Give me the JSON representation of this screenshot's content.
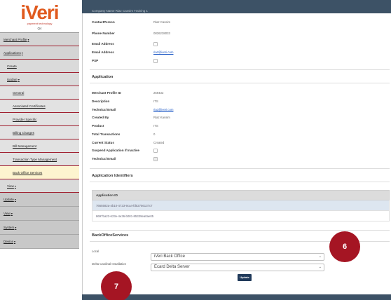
{
  "logo": {
    "text": "iVeri",
    "tagline": "payment technology",
    "subtitle": "Q4"
  },
  "sidebar": {
    "items": [
      {
        "label": "Merchant Profile",
        "caret": "▾"
      },
      {
        "label": "Applications",
        "caret": "▾"
      },
      {
        "label": "Create"
      },
      {
        "label": "Update",
        "caret": "▾"
      },
      {
        "label": "General"
      },
      {
        "label": "Associated Certificates"
      },
      {
        "label": "Provider Specific"
      },
      {
        "label": "Billing Charges"
      },
      {
        "label": "Bill Management"
      },
      {
        "label": "Transaction Type Management"
      },
      {
        "label": "Back Office Services"
      },
      {
        "label": "View",
        "caret": "▾"
      },
      {
        "label": "Update",
        "caret": "▾"
      },
      {
        "label": "View",
        "caret": "▾"
      },
      {
        "label": "System",
        "caret": "▾"
      },
      {
        "label": "Device",
        "caret": "▾"
      }
    ]
  },
  "header": {
    "partial_text": "Company Name            Riaz Cassim Training 1"
  },
  "company": {
    "contact_person_label": "ContactPerson",
    "contact_person_value": "Riaz Cassim",
    "phone_label": "Phone Number",
    "phone_value": "0826238033",
    "email1_label": "Email Address",
    "email2_label": "Email Address",
    "email2_value": "riaz@iveri.com",
    "psp_label": "PSP"
  },
  "application": {
    "title": "Application",
    "merchant_profile_id_label": "Merchant Profile ID",
    "merchant_profile_id_value": "259432",
    "description_label": "Description",
    "description_value": "ITS",
    "technical_email_label": "Technical Email",
    "technical_email_value": "riaz@iveri.com",
    "created_by_label": "Created By",
    "created_by_value": "Riaz Kassim",
    "product_label": "Product",
    "product_value": "ITS",
    "total_transactions_label": "Total Transactions",
    "total_transactions_value": "0",
    "current_status_label": "Current Status",
    "current_status_value": "Created",
    "suspend_label": "Suspend Application if Inactive",
    "technical_email2_label": "Technical Email"
  },
  "identifiers": {
    "title": "Application Identifiers",
    "column": "Application ID",
    "rows": [
      "7665582a-4b10-4723-9ca4-fd52756137c7",
      "8697ba23-623e-4e36-b081-85339ea0ae05"
    ]
  },
  "backoffice": {
    "title": "BackOfficeServices",
    "local_label": "Local",
    "local_value": "iVeri Back Office",
    "delta_label": "Delta Cardinal Installation",
    "delta_value": "Ecard Delta Server",
    "update_label": "Update"
  },
  "badges": {
    "six": "6",
    "seven": "7"
  },
  "colors": {
    "topbar": "#3d5266",
    "accent": "#a51523",
    "button": "#203a5a",
    "active_nav": "#fdf4cf"
  }
}
